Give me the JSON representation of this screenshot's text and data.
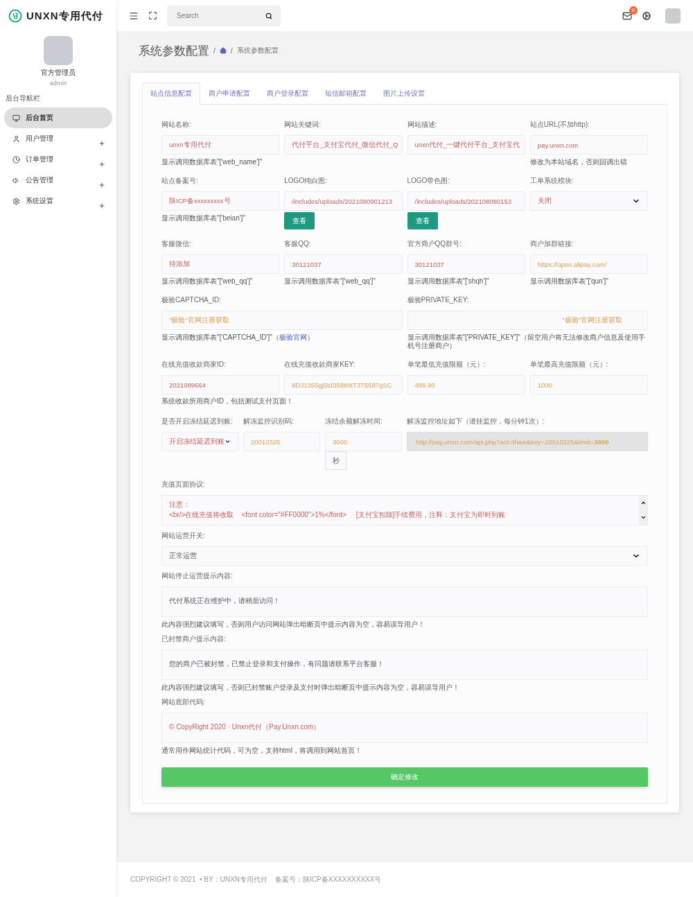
{
  "brand": {
    "name": "UNXN专用代付"
  },
  "user": {
    "name": "官方管理员",
    "role": "admin"
  },
  "nav": {
    "heading": "后台导航栏",
    "items": [
      {
        "label": "后台首页",
        "selected": true,
        "expandable": false
      },
      {
        "label": "用户管理",
        "selected": false,
        "expandable": true
      },
      {
        "label": "订单管理",
        "selected": false,
        "expandable": true
      },
      {
        "label": "公告管理",
        "selected": false,
        "expandable": true
      },
      {
        "label": "系统设置",
        "selected": false,
        "expandable": true
      }
    ]
  },
  "header": {
    "search_placeholder": "Search",
    "mail_badge": "0"
  },
  "page": {
    "title": "系统参数配置",
    "separators": [
      "/",
      "/"
    ],
    "breadcrumb": "系统参数配置"
  },
  "tabs": [
    {
      "label": "站点信息配置",
      "selected": true
    },
    {
      "label": "商户申请配置",
      "selected": false
    },
    {
      "label": "商户登录配置",
      "selected": false
    },
    {
      "label": "短信邮箱配置",
      "selected": false
    },
    {
      "label": "图片上传设置",
      "selected": false
    }
  ],
  "rows": [
    {
      "kind": "quad",
      "fields": [
        {
          "kind": "input",
          "label": "网站名称:",
          "value": "unxn专用代付",
          "hint": "显示调用数据库表\"['web_name']\""
        },
        {
          "kind": "input",
          "label": "网站关键词:",
          "value": "代付平台_支付宝代付_微信代付_Q"
        },
        {
          "kind": "input",
          "label": "网站描述:",
          "value": "unxn代付_一键代付平台_支付宝代"
        },
        {
          "kind": "input",
          "label": "站点URL(不加http):",
          "value": "pay.unxn.com",
          "hint": "修改为本站域名，否则回调出错"
        }
      ]
    },
    {
      "kind": "quad",
      "fields": [
        {
          "kind": "input",
          "label": "站点备案号:",
          "value": "陕ICP备xxxxxxxxx号",
          "hint": "显示调用数据库表\"['beian']\""
        },
        {
          "kind": "input",
          "label": "LOGO纯白图:",
          "value": "/includes/uploads/2021080901213",
          "button": "查看"
        },
        {
          "kind": "input",
          "label": "LOGO带色图:",
          "value": "/includes/uploads/202108090153",
          "button": "查看"
        },
        {
          "kind": "select",
          "label": "工单系统模块:",
          "value": "关闭"
        }
      ]
    },
    {
      "kind": "quad",
      "fields": [
        {
          "kind": "input",
          "label": "客服微信:",
          "value": "待添加",
          "hint": "显示调用数据库表\"['web_qq']\""
        },
        {
          "kind": "input",
          "label": "客服QQ:",
          "value": "30121037",
          "hint": "显示调用数据库表\"['web_qq']\""
        },
        {
          "kind": "input",
          "label": "官方商户QQ群号:",
          "value": "30121037",
          "hint": "显示调用数据库表\"['shqh']\""
        },
        {
          "kind": "input",
          "label": "商户加群链接:",
          "placeholder": "https://open.alipay.com/",
          "hint": "显示调用数据库表\"['qun']\""
        }
      ]
    },
    {
      "kind": "pair",
      "fields": [
        {
          "kind": "input",
          "label": "极验CAPTCHA_ID:",
          "placeholder": "\"极验\"官网注册获取",
          "hint": "显示调用数据库表\"['CAPTCHA_ID']\"（",
          "hint_link": "极验官网",
          "hint_end": "）"
        },
        {
          "kind": "input",
          "label": "极验PRIVATE_KEY:",
          "placeholder": "\"极验\"官网注册获取",
          "hint": "显示调用数据库表\"['PRIVATE_KEY']\"（留空用户将无法修改商户信息及使用手机号注册商户）"
        }
      ]
    },
    {
      "kind": "quad",
      "note": "系统收款所用商户ID，包括测试支付页面！",
      "fields": [
        {
          "kind": "input",
          "label": "在线充值收款商家ID:",
          "value": "2021089664"
        },
        {
          "kind": "input",
          "label": "在线充值收款商家KEY:",
          "placeholder": "8DJ1355gj5td35889tT3T5587gSC"
        },
        {
          "kind": "input",
          "label": "单笔最低充值限额（元）:",
          "placeholder": "499.90"
        },
        {
          "kind": "input",
          "label": "单笔最高充值限额（元）:",
          "placeholder": "1000"
        }
      ]
    },
    {
      "kind": "freeze",
      "fields": [
        {
          "kind": "select",
          "label": "是否开启冻结延迟到账:",
          "value": "开启冻结延迟到账"
        },
        {
          "kind": "input",
          "label": "解冻监控识别码:",
          "placeholder": "20010325"
        },
        {
          "kind": "input",
          "label": "冻结余额解冻时间:",
          "placeholder": "3600",
          "addon": "秒"
        },
        {
          "kind": "readonly",
          "label": "解冻监控地址如下（请挂监控，每分钟1次）:",
          "value": "http://pay.unxn.com/api.php?act=thaw&key=20010325&limit=**3600**"
        }
      ]
    },
    {
      "kind": "full",
      "fields": [
        {
          "kind": "code",
          "label": "充值页面协议:",
          "lines": [
            "注意：",
            "<br/>在线充值将收取    <font color=\"#FF0000\">1%</font>     [支付宝扣除]手续费用，注释：支付宝为即时到账"
          ]
        }
      ]
    },
    {
      "kind": "full",
      "fields": [
        {
          "kind": "select",
          "label": "网站运营开关:",
          "value": "正常运营"
        }
      ]
    },
    {
      "kind": "full",
      "fields": [
        {
          "kind": "textarea",
          "label": "网站停止运营提示内容:",
          "value": "代付系统正在维护中，请稍后访问！",
          "hint": "此内容强烈建议填写，否则用户访问网站弹出暗断页中提示内容为空，容易误导用户！"
        }
      ]
    },
    {
      "kind": "full",
      "fields": [
        {
          "kind": "textarea",
          "label": "已封禁商户提示内容:",
          "value": "您的商户已被封禁，已禁止登录和支付操作，有问题请联系平台客服！",
          "hint": "此内容强烈建议填写，否则已封禁账户登录及支付时弹出暗断页中提示内容为空，容易误导用户！"
        }
      ]
    },
    {
      "kind": "full",
      "fields": [
        {
          "kind": "html",
          "label": "网站底部代码:",
          "value": "© CopyRight 2020 · Unxn代付（Pay.Unxn.com）",
          "hint": "通常用作网站统计代码，可为空，支持html，将调用到网站首页！"
        }
      ]
    }
  ],
  "submit": "确定修改",
  "footer": "COPYRIGHT © 2021  • BY：UNXN专用代付    备案号：陕ICP备XXXXXXXXXX号"
}
